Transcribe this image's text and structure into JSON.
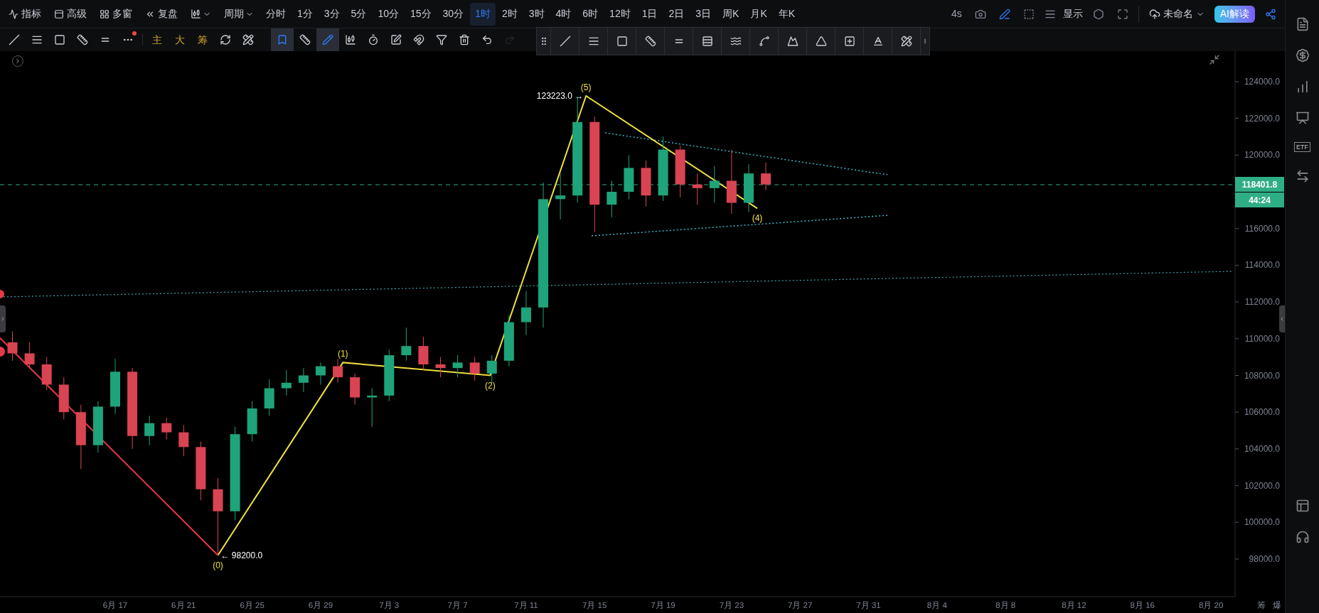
{
  "top_bar": {
    "menu": [
      {
        "label": "指标"
      },
      {
        "label": "高级"
      },
      {
        "label": "多窗"
      },
      {
        "label": "复盘"
      }
    ],
    "period_menu": "周期",
    "periods": [
      {
        "label": "分时",
        "selected": false
      },
      {
        "label": "1分",
        "selected": false
      },
      {
        "label": "3分",
        "selected": false
      },
      {
        "label": "5分",
        "selected": false
      },
      {
        "label": "10分",
        "selected": false
      },
      {
        "label": "15分",
        "selected": false
      },
      {
        "label": "30分",
        "selected": false
      },
      {
        "label": "1时",
        "selected": true
      },
      {
        "label": "2时",
        "selected": false
      },
      {
        "label": "3时",
        "selected": false
      },
      {
        "label": "4时",
        "selected": false
      },
      {
        "label": "6时",
        "selected": false
      },
      {
        "label": "12时",
        "selected": false
      },
      {
        "label": "1日",
        "selected": false
      },
      {
        "label": "2日",
        "selected": false
      },
      {
        "label": "3日",
        "selected": false
      },
      {
        "label": "周K",
        "selected": false
      },
      {
        "label": "月K",
        "selected": false
      },
      {
        "label": "年K",
        "selected": false
      }
    ],
    "refresh": "4s",
    "display": "显示",
    "layout_name": "未命名",
    "ai_button": "AI解读"
  },
  "toolbar": {
    "indicators": [
      {
        "label": "主"
      },
      {
        "label": "大"
      },
      {
        "label": "筹"
      }
    ],
    "tools": [
      {
        "selected": true
      },
      {
        "selected": false
      },
      {
        "selected": true
      },
      {
        "selected": false
      },
      {
        "selected": false
      },
      {
        "selected": false
      },
      {
        "selected": false
      },
      {
        "selected": false
      },
      {
        "selected": false
      },
      {
        "disabled": false
      },
      {
        "disabled": true
      }
    ]
  },
  "sidebar": {
    "items": [
      {
        "kind": "icon"
      },
      {
        "kind": "icon"
      },
      {
        "kind": "icon"
      },
      {
        "kind": "icon"
      },
      {
        "kind": "text",
        "label": "ETF"
      },
      {
        "kind": "icon"
      },
      {
        "kind": "icon"
      },
      {
        "kind": "icon"
      }
    ]
  },
  "chart": {
    "current_price": "118401.8",
    "countdown": "44:24",
    "footer": [
      "筹",
      "爆"
    ],
    "wave_labels": [
      {
        "text": "(0)"
      },
      {
        "text": "(1)"
      },
      {
        "text": "(2)"
      },
      {
        "text": "(5)"
      },
      {
        "text": "(4)"
      }
    ],
    "price_marks": [
      {
        "text": "← 98200.0"
      },
      {
        "text": "123223.0 →"
      }
    ],
    "chart_data": {
      "type": "candlestick",
      "categories": [
        null,
        null,
        null,
        null,
        null,
        null,
        "6月 17",
        null,
        null,
        null,
        "6月 21",
        null,
        null,
        null,
        "6月 25",
        null,
        null,
        null,
        "6月 29",
        null,
        null,
        null,
        "7月 3",
        null,
        null,
        null,
        "7月 7",
        null,
        null,
        null,
        "7月 11",
        null,
        null,
        null,
        "7月 15",
        null,
        null,
        null,
        "7月 19",
        null,
        null,
        null,
        "7月 23",
        null,
        null,
        null,
        "7月 27",
        null,
        null,
        null,
        "7月 31",
        null,
        null,
        null,
        "8月 4",
        null,
        null,
        null,
        "8月 8",
        null,
        null,
        null,
        "8月 12",
        null,
        null,
        null,
        "8月 16",
        null,
        null,
        null,
        "8月 20"
      ],
      "ohlc": [
        [
          109800,
          110400,
          108800,
          109200
        ],
        [
          109200,
          109800,
          108400,
          108600
        ],
        [
          108600,
          109000,
          107200,
          107500
        ],
        [
          107500,
          107900,
          105600,
          106000
        ],
        [
          106000,
          106400,
          102900,
          104200
        ],
        [
          104200,
          106600,
          103800,
          106300
        ],
        [
          106300,
          108900,
          105900,
          108200
        ],
        [
          108200,
          108400,
          104000,
          104700
        ],
        [
          104700,
          105800,
          104200,
          105400
        ],
        [
          105400,
          105700,
          104500,
          104900
        ],
        [
          104900,
          105300,
          103600,
          104100
        ],
        [
          104100,
          104400,
          101200,
          101800
        ],
        [
          101800,
          102400,
          98200,
          100600
        ],
        [
          100600,
          105200,
          100100,
          104800
        ],
        [
          104800,
          106600,
          104400,
          106200
        ],
        [
          106200,
          107800,
          105800,
          107300
        ],
        [
          107300,
          108300,
          106900,
          107600
        ],
        [
          107600,
          108400,
          107100,
          108000
        ],
        [
          108000,
          108700,
          107500,
          108500
        ],
        [
          108500,
          108900,
          107600,
          107900
        ],
        [
          107900,
          108100,
          106400,
          106800
        ],
        [
          106800,
          107300,
          105200,
          106900
        ],
        [
          106900,
          109400,
          106600,
          109100
        ],
        [
          109100,
          110600,
          108800,
          109600
        ],
        [
          109600,
          110100,
          108300,
          108600
        ],
        [
          108600,
          109000,
          107900,
          108400
        ],
        [
          108400,
          109100,
          107900,
          108700
        ],
        [
          108700,
          109000,
          107700,
          108100
        ],
        [
          108100,
          109100,
          107600,
          108800
        ],
        [
          108800,
          111300,
          108500,
          110900
        ],
        [
          110900,
          112600,
          110200,
          111700
        ],
        [
          111700,
          118500,
          110600,
          117600
        ],
        [
          117600,
          119000,
          116500,
          117800
        ],
        [
          117800,
          123200,
          117400,
          121800
        ],
        [
          121800,
          122100,
          115800,
          117300
        ],
        [
          117300,
          118600,
          116600,
          118000
        ],
        [
          118000,
          120000,
          117600,
          119300
        ],
        [
          119300,
          119700,
          117200,
          117800
        ],
        [
          117800,
          121000,
          117500,
          120300
        ],
        [
          120300,
          120500,
          117700,
          118400
        ],
        [
          118400,
          119000,
          117300,
          118200
        ],
        [
          118200,
          119400,
          117400,
          118600
        ],
        [
          118600,
          120300,
          116800,
          117400
        ],
        [
          117400,
          119500,
          116900,
          119000
        ],
        [
          119000,
          119600,
          118100,
          118400
        ],
        null,
        null,
        null,
        null,
        null,
        null,
        null,
        null,
        null,
        null,
        null,
        null,
        null,
        null,
        null,
        null,
        null,
        null,
        null,
        null,
        null,
        null,
        null,
        null,
        null,
        null
      ],
      "ylim": [
        95950,
        125660
      ],
      "yticks": [
        {
          "value": 98000,
          "label": "98000.0"
        },
        {
          "value": 100000,
          "label": "100000.0"
        },
        {
          "value": 102000,
          "label": "102000.0"
        },
        {
          "value": 104000,
          "label": "104000.0"
        },
        {
          "value": 106000,
          "label": "106000.0"
        },
        {
          "value": 108000,
          "label": "108000.0"
        },
        {
          "value": 110000,
          "label": "110000.0"
        },
        {
          "value": 112000,
          "label": "112000.0"
        },
        {
          "value": 114000,
          "label": "114000.0"
        },
        {
          "value": 116000,
          "label": "116000.0"
        },
        {
          "value": 120000,
          "label": "120000.0"
        },
        {
          "value": 122000,
          "label": "122000.0"
        },
        {
          "value": 124000,
          "label": "124000.0"
        }
      ]
    }
  }
}
